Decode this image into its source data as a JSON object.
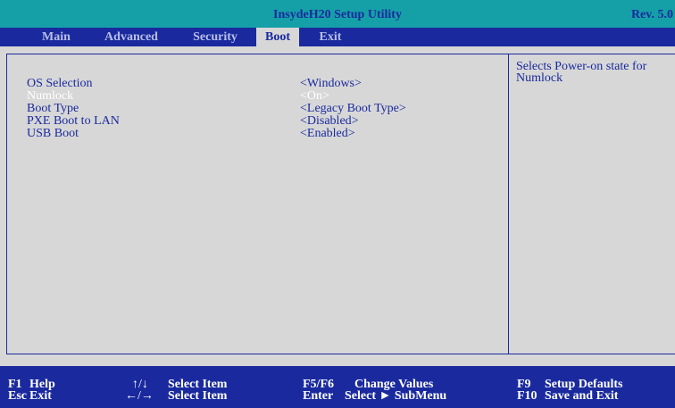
{
  "header": {
    "title": "InsydeH20 Setup Utility",
    "revision": "Rev. 5.0"
  },
  "tabs": [
    {
      "label": "Main"
    },
    {
      "label": "Advanced"
    },
    {
      "label": "Security"
    },
    {
      "label": "Boot",
      "active": true
    },
    {
      "label": "Exit"
    }
  ],
  "settings": [
    {
      "label": "OS Selection",
      "value": "<Windows>"
    },
    {
      "label": "Numlock",
      "value": "<On>",
      "selected": true
    },
    {
      "label": "Boot Type",
      "value": "<Legacy Boot Type>"
    },
    {
      "label": "PXE Boot to LAN",
      "value": "<Disabled>"
    },
    {
      "label": "USB Boot",
      "value": "<Enabled>"
    }
  ],
  "help": {
    "text": "Selects Power-on state for Numlock"
  },
  "footer": {
    "f1_key": "F1",
    "f1_desc": "Help",
    "esc_key": "Esc",
    "esc_desc": "Exit",
    "updown_key": "↑/↓",
    "updown_desc": "Select Item",
    "leftright_key": "←/→",
    "leftright_desc": "Select Item",
    "f5f6_key": "F5/F6",
    "f5f6_desc": "Change Values",
    "enter_key": "Enter",
    "enter_desc": "Select ► SubMenu",
    "f9_key": "F9",
    "f9_desc": "Setup Defaults",
    "f10_key": "F10",
    "f10_desc": "Save and Exit"
  },
  "colors": {
    "title_bg": "#15a0a8",
    "accent_blue": "#1a2a9e",
    "panel_bg": "#d7d7d7",
    "selected_text": "#ffffff"
  }
}
